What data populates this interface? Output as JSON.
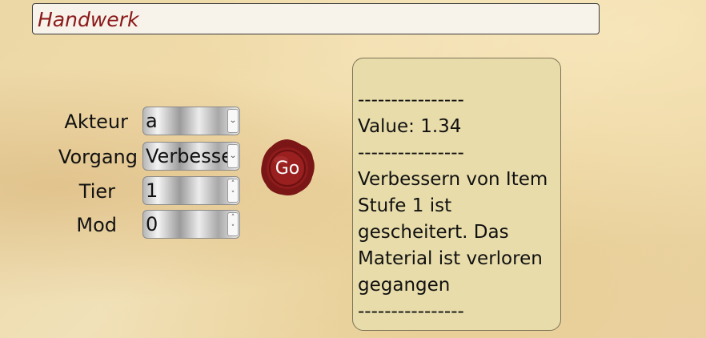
{
  "header": {
    "title": "Handwerk"
  },
  "form": {
    "actor": {
      "label": "Akteur",
      "value": "a"
    },
    "process": {
      "label": "Vorgang",
      "value": "Verbessern"
    },
    "tier": {
      "label": "Tier",
      "value": "1"
    },
    "mod": {
      "label": "Mod",
      "value": "0"
    }
  },
  "go_button": {
    "label": "Go",
    "color": "#8b1a1a"
  },
  "output": {
    "separator_top": "----------------",
    "value_line": "Value: 1.34",
    "separator_mid": "----------------",
    "message": "Verbessern von Item Stufe 1 ist gescheitert. Das Material ist verloren gegangen",
    "separator_bottom": "----------------"
  },
  "colors": {
    "title_text": "#8b1a1a",
    "panel_background": "#e8dcaa"
  }
}
